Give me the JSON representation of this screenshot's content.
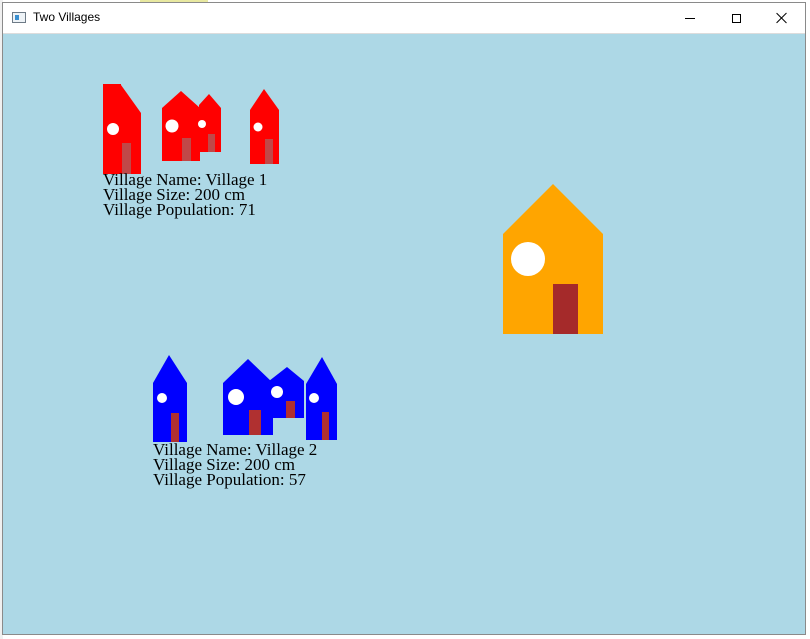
{
  "window": {
    "title": "Two Villages",
    "icon": "app-window-icon",
    "controls": [
      "minimize-icon",
      "maximize-icon",
      "close-icon"
    ]
  },
  "colors": {
    "background": "#add8e6",
    "village1_houses": "#ff0000",
    "village2_houses": "#0000ff",
    "big_house": "#ffa500",
    "window": "#ffffff",
    "door_on_red": "#c04848",
    "door_on_blue": "#b03030",
    "door_big": "#a52a2a"
  },
  "villages": [
    {
      "name_line": "Village Name: Village 1",
      "size_line": "Village Size: 200 cm",
      "population_line": "Village Population: 71"
    },
    {
      "name_line": "Village Name: Village 2",
      "size_line": "Village Size: 200 cm",
      "population_line": "Village Population: 57"
    }
  ]
}
